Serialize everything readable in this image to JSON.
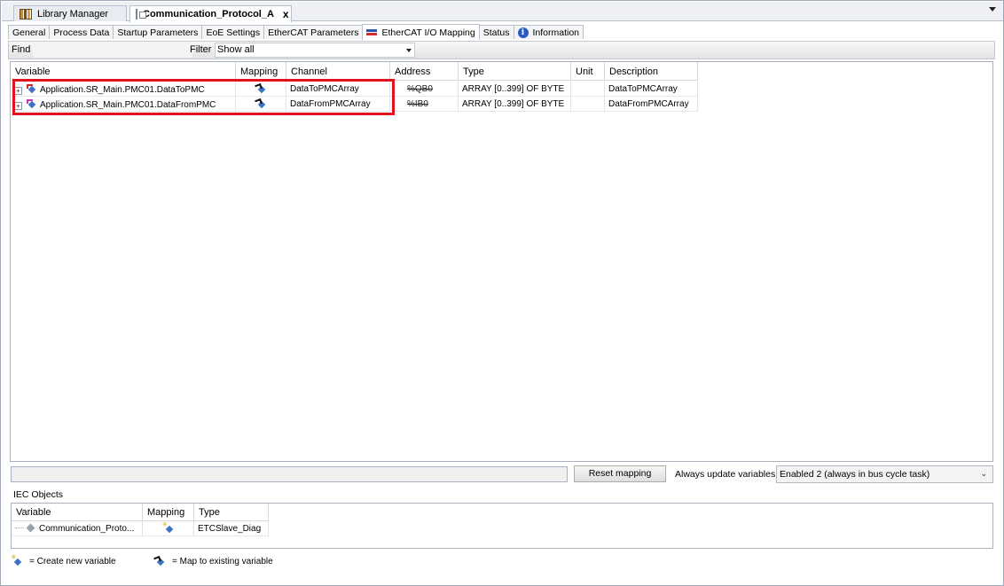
{
  "doc_tabs": {
    "library_manager": "Library Manager",
    "active_doc": "Communication_Protocol_A",
    "close": "x"
  },
  "editor_tabs": [
    "General",
    "Process Data",
    "Startup Parameters",
    "EoE Settings",
    "EtherCAT Parameters",
    "EtherCAT I/O Mapping",
    "Status",
    "Information"
  ],
  "find_bar": {
    "find_label": "Find",
    "filter_label": "Filter",
    "filter_value": "Show all"
  },
  "mapping_table": {
    "columns": [
      "Variable",
      "Mapping",
      "Channel",
      "Address",
      "Type",
      "Unit",
      "Description"
    ],
    "rows": [
      {
        "variable": "Application.SR_Main.PMC01.DataToPMC",
        "channel": "DataToPMCArray",
        "address": "%QB0",
        "type": "ARRAY [0..399] OF BYTE",
        "unit": "",
        "description": "DataToPMCArray"
      },
      {
        "variable": "Application.SR_Main.PMC01.DataFromPMC",
        "channel": "DataFromPMCArray",
        "address": "%IB0",
        "type": "ARRAY [0..399] OF BYTE",
        "unit": "",
        "description": "DataFromPMCArray"
      }
    ]
  },
  "bottom_bar": {
    "reset_label": "Reset mapping",
    "always_update_label": "Always update variables:",
    "always_update_value": "Enabled 2 (always in bus cycle task)"
  },
  "iec_objects": {
    "title": "IEC Objects",
    "columns": [
      "Variable",
      "Mapping",
      "Type"
    ],
    "rows": [
      {
        "variable": "Communication_Proto...",
        "type": "ETCSlave_Diag"
      }
    ]
  },
  "legend": {
    "create_new": "= Create new variable",
    "map_existing": "= Map to existing variable"
  },
  "colors": {
    "highlight": "#e0141e",
    "accent_blue": "#2a5bc5"
  }
}
